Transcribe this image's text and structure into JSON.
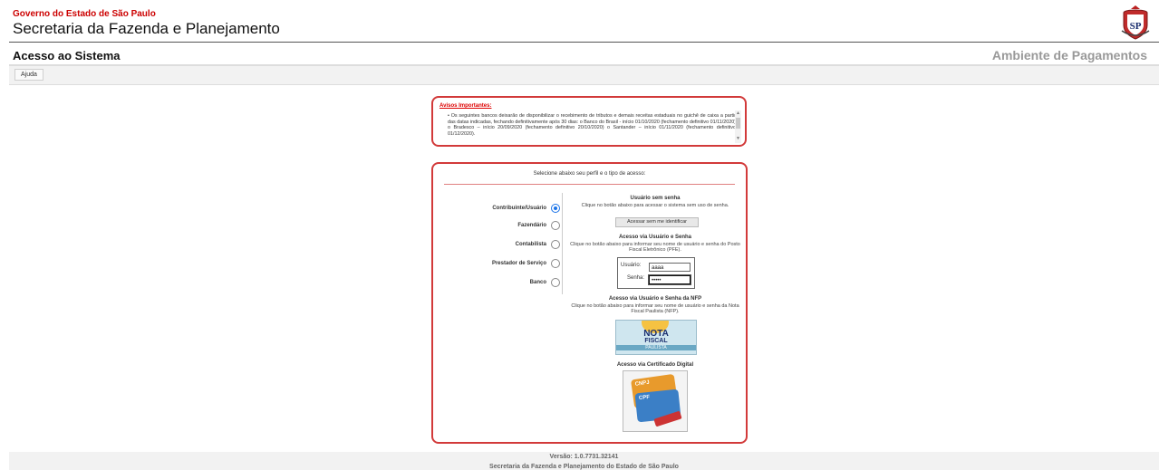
{
  "header": {
    "government": "Governo do Estado de São Paulo",
    "secretariat": "Secretaria da Fazenda e Planejamento",
    "logo_icon": "sao-paulo-coat-of-arms-icon",
    "logo_text": "SP"
  },
  "titlebar": {
    "title": "Acesso ao Sistema",
    "environment": "Ambiente de Pagamentos"
  },
  "tabs": [
    "Ajuda"
  ],
  "notice": {
    "title": "Avisos Importantes:",
    "bullet": "•",
    "text": "• Os seguintes bancos deixarão de disponibilizar o recebimento de tributos e demais receitas estaduais no guichê de caixa a partir das datas indicadas, fechando definitivamente após 30 dias: o Banco do Brasil - início 01/10/2020 (fechamento definitivo 01/11/2020) o Bradesco – início 20/09/2020 (fechamento definitivo 20/10/2020) o Santander – início 01/11/2020 (fechamento definitivo 01/12/2020)."
  },
  "login": {
    "prompt": "Selecione abaixo seu perfil e o tipo de acesso:",
    "profiles": [
      {
        "label": "Contribuinte/Usuário",
        "checked": true
      },
      {
        "label": "Fazendário",
        "checked": false
      },
      {
        "label": "Contabilista",
        "checked": false
      },
      {
        "label": "Prestador de Serviço",
        "checked": false
      },
      {
        "label": "Banco",
        "checked": false
      }
    ],
    "no_password": {
      "title": "Usuário sem senha",
      "desc": "Clique no botão abaixo para acessar o sistema sem uso de senha.",
      "button": "Acessar sem me identificar"
    },
    "user_password": {
      "title": "Acesso via Usuário e Senha",
      "desc": "Clique no botão abaixo para informar seu nome de usuário e senha do Posto Fiscal Eletrônico (PFE).",
      "user_label": "Usuário:",
      "user_value": "aaaa",
      "pass_label": "Senha:",
      "pass_value": "•••••"
    },
    "nfp": {
      "title": "Acesso via Usuário e Senha da NFP",
      "desc": "Clique no botão abaixo para informar seu nome de usuário e senha da Nota Fiscal Paulista (NFP).",
      "logo_line1": "NOTA",
      "logo_line2": "FISCAL",
      "logo_line3": "PAULISTA"
    },
    "certificate": {
      "title": "Acesso via Certificado Digital",
      "card1": "CNPJ",
      "card2": "CPF"
    }
  },
  "footer": {
    "version": "Versão: 1.0.7731.32141",
    "org": "Secretaria da Fazenda e Planejamento do Estado de São Paulo"
  }
}
